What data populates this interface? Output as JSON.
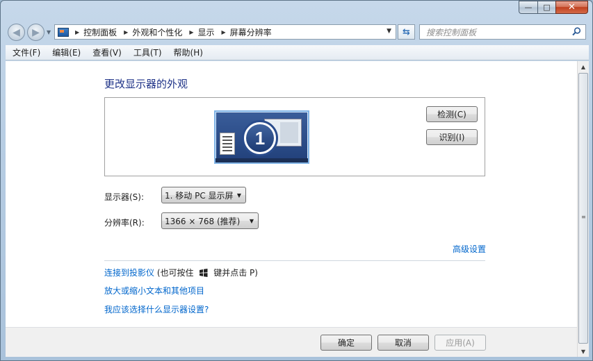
{
  "window": {
    "controls": {
      "minimize": "—",
      "maximize": "□",
      "close": "✕"
    }
  },
  "nav": {
    "breadcrumbs": [
      "控制面板",
      "外观和个性化",
      "显示",
      "屏幕分辨率"
    ],
    "search_placeholder": "搜索控制面板"
  },
  "menu": [
    "文件(F)",
    "编辑(E)",
    "查看(V)",
    "工具(T)",
    "帮助(H)"
  ],
  "main": {
    "title": "更改显示器的外观",
    "monitor_number": "1",
    "detect_button": "检测(C)",
    "identify_button": "识别(I)",
    "display_label": "显示器(S):",
    "display_value": "1. 移动 PC 显示屏",
    "resolution_label": "分辨率(R):",
    "resolution_value": "1366 × 768 (推荐)",
    "advanced_link": "高级设置",
    "projector_link": "连接到投影仪",
    "projector_hint_prefix": "(也可按住",
    "projector_hint_suffix": "键并点击 P)",
    "text_size_link": "放大或缩小文本和其他项目",
    "which_settings_link": "我应该选择什么显示器设置?"
  },
  "footer": {
    "ok": "确定",
    "cancel": "取消",
    "apply": "应用(A)"
  },
  "colors": {
    "link": "#0066cc",
    "title": "#1e3287",
    "close_button": "#c0401f"
  }
}
